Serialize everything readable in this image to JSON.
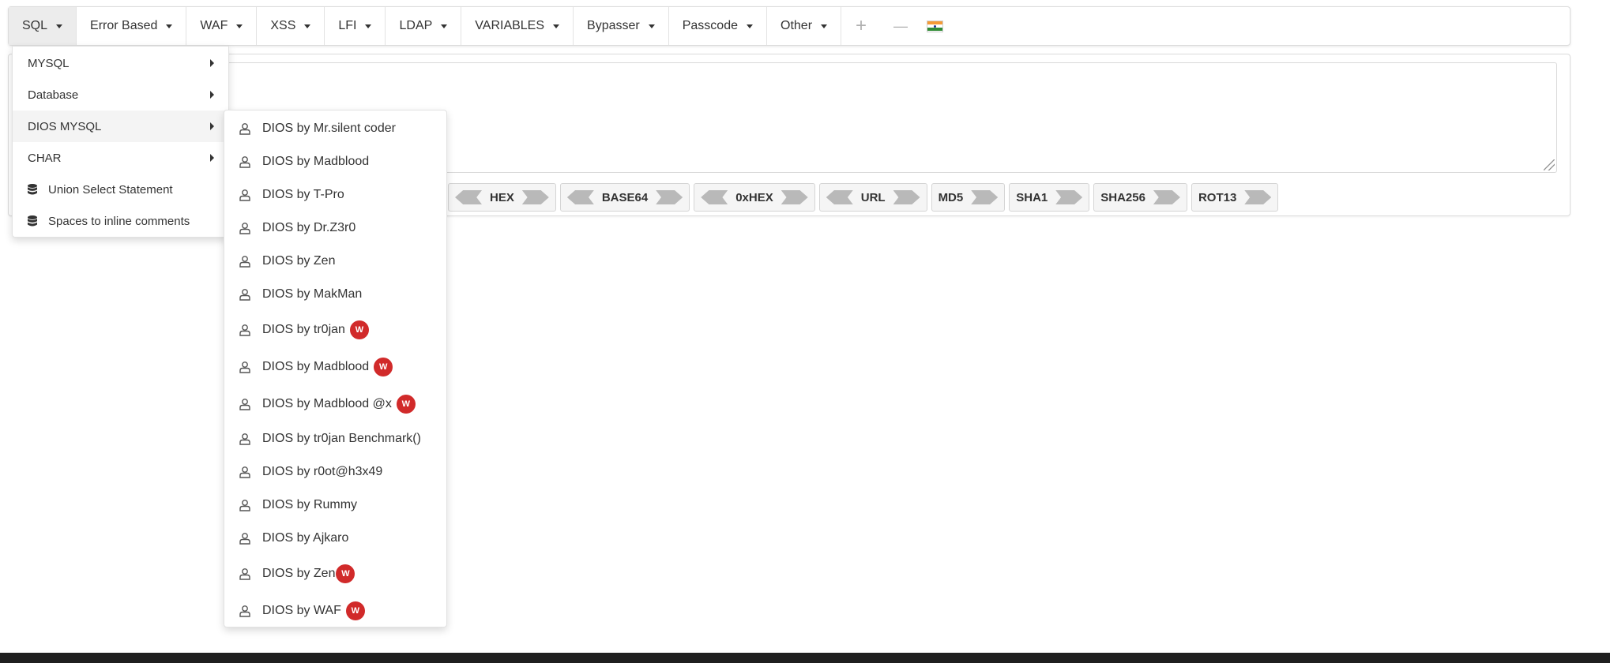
{
  "nav": {
    "items": [
      {
        "label": "SQL"
      },
      {
        "label": "Error Based"
      },
      {
        "label": "WAF"
      },
      {
        "label": "XSS"
      },
      {
        "label": "LFI"
      },
      {
        "label": "LDAP"
      },
      {
        "label": "VARIABLES"
      },
      {
        "label": "Bypasser"
      },
      {
        "label": "Passcode"
      },
      {
        "label": "Other"
      }
    ],
    "icons": [
      "plus-icon",
      "minus-icon",
      "india-flag-icon"
    ],
    "plus_glyph": "+",
    "minus_glyph": "—"
  },
  "sql_menu": {
    "items": [
      {
        "label": "MYSQL",
        "submenu": true
      },
      {
        "label": "Database",
        "submenu": true
      },
      {
        "label": "DIOS MYSQL",
        "submenu": true
      },
      {
        "label": "CHAR",
        "submenu": true
      },
      {
        "label": "Union Select Statement",
        "icon": "database-icon"
      },
      {
        "label": "Spaces to inline comments",
        "icon": "database-icon"
      }
    ]
  },
  "dios_menu": {
    "items": [
      {
        "label": "DIOS by Mr.silent coder",
        "badge": ""
      },
      {
        "label": "DIOS by Madblood",
        "badge": ""
      },
      {
        "label": "DIOS by T-Pro",
        "badge": ""
      },
      {
        "label": "DIOS by Dr.Z3r0",
        "badge": ""
      },
      {
        "label": "DIOS by Zen",
        "badge": ""
      },
      {
        "label": "DIOS by MakMan",
        "badge": ""
      },
      {
        "label": "DIOS by tr0jan",
        "badge": "W"
      },
      {
        "label": "DIOS by Madblood",
        "badge": "W"
      },
      {
        "label": "DIOS by Madblood @x",
        "badge": "W"
      },
      {
        "label": "DIOS by tr0jan Benchmark()",
        "badge": ""
      },
      {
        "label": "DIOS by r0ot@h3x49",
        "badge": ""
      },
      {
        "label": "DIOS by Rummy",
        "badge": ""
      },
      {
        "label": "DIOS by Ajkaro",
        "badge": ""
      },
      {
        "label": "DIOS by Zen",
        "badge": "W"
      },
      {
        "label": "DIOS by WAF",
        "badge": "W"
      }
    ]
  },
  "encoders": [
    {
      "label": "HEX",
      "arrows": "both"
    },
    {
      "label": "BASE64",
      "arrows": "both"
    },
    {
      "label": "0xHEX",
      "arrows": "both"
    },
    {
      "label": "URL",
      "arrows": "both"
    },
    {
      "label": "MD5",
      "arrows": "right"
    },
    {
      "label": "SHA1",
      "arrows": "right"
    },
    {
      "label": "SHA256",
      "arrows": "right"
    },
    {
      "label": "ROT13",
      "arrows": "right"
    }
  ],
  "colors": {
    "badge": "#d12a2a",
    "active_nav": "#ececec",
    "arrow": "#b9b9b9"
  }
}
